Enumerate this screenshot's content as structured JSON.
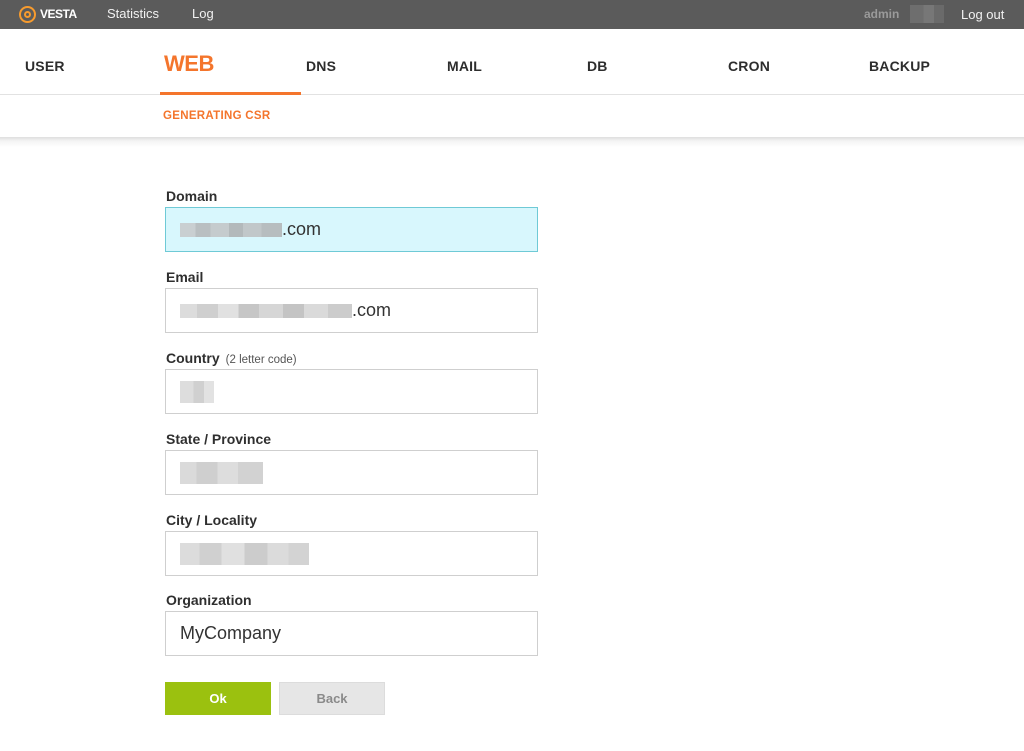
{
  "topbar": {
    "logo_text": "VESTA",
    "links": [
      "Statistics",
      "Log"
    ],
    "user": "admin",
    "logout": "Log out"
  },
  "nav": {
    "items": [
      "USER",
      "WEB",
      "DNS",
      "MAIL",
      "DB",
      "CRON",
      "BACKUP"
    ],
    "active": "WEB"
  },
  "subnav": {
    "label": "GENERATING CSR"
  },
  "form": {
    "domain": {
      "label": "Domain",
      "value_suffix": ".com"
    },
    "email": {
      "label": "Email",
      "value_suffix": ".com"
    },
    "country": {
      "label": "Country",
      "hint": "(2 letter code)"
    },
    "state": {
      "label": "State / Province"
    },
    "city": {
      "label": "City / Locality"
    },
    "organization": {
      "label": "Organization",
      "value": "MyCompany"
    }
  },
  "buttons": {
    "ok": "Ok",
    "back": "Back"
  },
  "colors": {
    "accent": "#f4752c",
    "topbar": "#5b5b5b",
    "ok_button": "#9bc10f",
    "focused_field": "#d8f7fd"
  }
}
